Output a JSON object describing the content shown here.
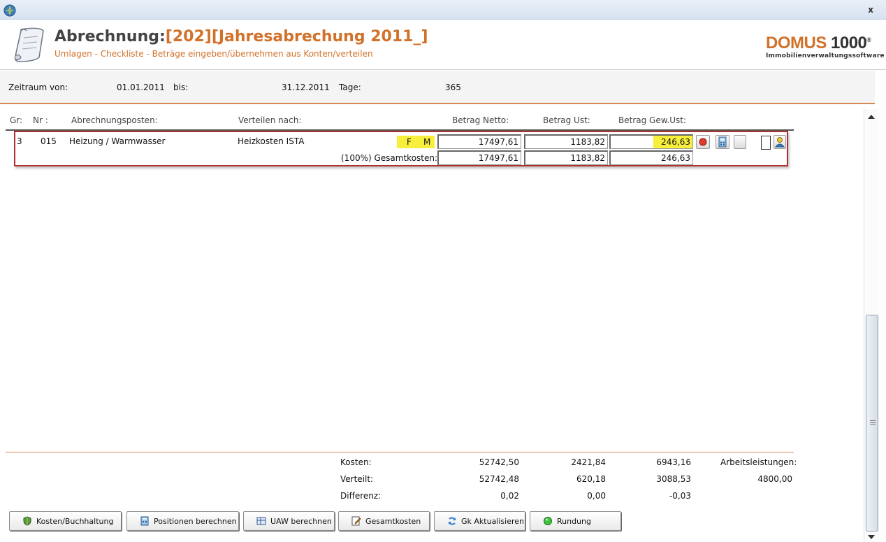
{
  "window": {
    "close_label": "x"
  },
  "header": {
    "title_prefix": "Abrechnung:",
    "title_highlight": "[202][Jahresabrechung 2011_]",
    "subtitle": "Umlagen - Checkliste - Beträge eingeben/übernehmen aus Konten/verteilen",
    "brand_domus": "DOMUS",
    "brand_number": "1000",
    "brand_reg": "®",
    "brand_tagline": "Immobilienverwaltungssoftware"
  },
  "period": {
    "from_label": "Zeitraum von:",
    "from_value": "01.01.2011",
    "to_label": "bis:",
    "to_value": "31.12.2011",
    "days_label": "Tage:",
    "days_value": "365"
  },
  "columns": {
    "gr": "Gr:",
    "nr": "Nr :",
    "posten": "Abrechnungsposten:",
    "verteilen": "Verteilen nach:",
    "netto": "Betrag Netto:",
    "ust": "Betrag Ust:",
    "gewust": "Betrag Gew.Ust:"
  },
  "row": {
    "gr": "3",
    "nr": "015",
    "posten": "Heizung / Warmwasser",
    "verteilen": "Heizkosten ISTA",
    "flag_f": "F",
    "flag_m": "M",
    "netto": "17497,61",
    "ust": "1183,82",
    "gewust": "246,63",
    "total_label": "(100%) Gesamtkosten:",
    "total_netto": "17497,61",
    "total_ust": "1183,82",
    "total_gewust": "246,63"
  },
  "totals": {
    "kosten_label": "Kosten:",
    "kosten_netto": "52742,50",
    "kosten_ust": "2421,84",
    "kosten_gewust": "6943,16",
    "verteilt_label": "Verteilt:",
    "verteilt_netto": "52742,48",
    "verteilt_ust": "620,18",
    "verteilt_gewust": "3088,53",
    "differenz_label": "Differenz:",
    "differenz_netto": "0,02",
    "differenz_ust": "0,00",
    "differenz_gewust": "-0,03",
    "arbeit_label": "Arbeitsleistungen:",
    "arbeit_value": "4800,00"
  },
  "buttons": {
    "kosten": "Kosten/Buchhaltung",
    "positionen": "Positionen berechnen",
    "uaw": "UAW berechnen",
    "gesamt": "Gesamtkosten",
    "gk": "Gk Aktualisieren",
    "rundung": "Rundung"
  },
  "colors": {
    "accent": "#d2712a",
    "highlight": "#f7ef3c",
    "row_border": "#b03030"
  }
}
